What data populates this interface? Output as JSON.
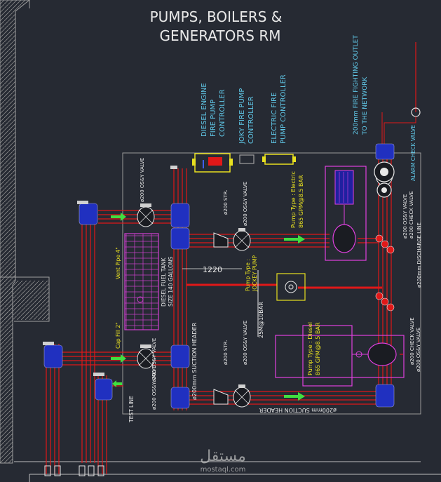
{
  "title": {
    "line1": "PUMPS, BOILERS &",
    "line2": "GENERATORS RM"
  },
  "controllers": {
    "diesel": [
      "DIESEL ENGINE",
      "FIRE PUMP",
      "CONTROLLER"
    ],
    "jockey": [
      "JOKY FIRE PUMP",
      "CONTROLLER"
    ],
    "electric": [
      "ELECTRIC FIRE",
      "PUMP CONTROLLER"
    ]
  },
  "outlet": [
    "200mm FIRE FIGHTING OUTLET",
    "TO THE NETWORK"
  ],
  "alarm_valve": "ALARM CHECK VALVE",
  "electric_pump": [
    "Pump Type : Electric",
    "865 GPM@8.5 BAR"
  ],
  "diesel_pump": [
    "Pump Type : Diesel",
    "865 GPM@8.5 BAR"
  ],
  "jockey_pump": [
    "Pump Type :",
    "JOCKEY PUMP"
  ],
  "jockey_bar": "25M@10BAR",
  "suction_header_v": "ø200mm SUCTION HEADER",
  "suction_header_h": "ø200mm SUCTION HEADER",
  "dimension": "1220",
  "tank": [
    "DIESEL FUEL TANK",
    "SIZE 140 GALLONS"
  ],
  "vent_pipe": "Vent Pipe 4\"",
  "cap_fill": "Cap Fill 2\"",
  "test_line": "TEST LINE",
  "valves": {
    "os_y_1": "ø200 OS&Y VALVE",
    "os_y_2": "ø200 OS&Y VALVE",
    "os_y_3": "ø200 OS&Y VALVE",
    "os_y_4": "ø200 OS&Y VALVE",
    "os_y_5": "ø200 OS&Y VALVE",
    "strainer_1": "ø200 STR.",
    "strainer_2": "ø200 STR.",
    "check_os_y_top": [
      "ø200 OS&Y VALVE",
      "ø200 CHECK VALVE"
    ],
    "discharge_top": [
      "ø200 CHECK VALVE",
      "ø200 OS&Y VALVE"
    ],
    "discharge_line": "ø200mm DISCHARGE LINE",
    "discharge_bot": [
      "ø200 CHECK VALVE",
      "ø200 OS&Y VALVE"
    ]
  },
  "watermark": {
    "arabic": "مستقل",
    "latin": "mostaql.com"
  },
  "colors": {
    "bg": "#262a33",
    "pipe_red": "#e01818",
    "pipe_dark": "#b01010",
    "magenta": "#e040e0",
    "yellow": "#e8e020",
    "cyan_text": "#60c8e8",
    "white": "#e8e8e8",
    "green_arrow": "#40e040",
    "wall": "#9a9a9a"
  }
}
